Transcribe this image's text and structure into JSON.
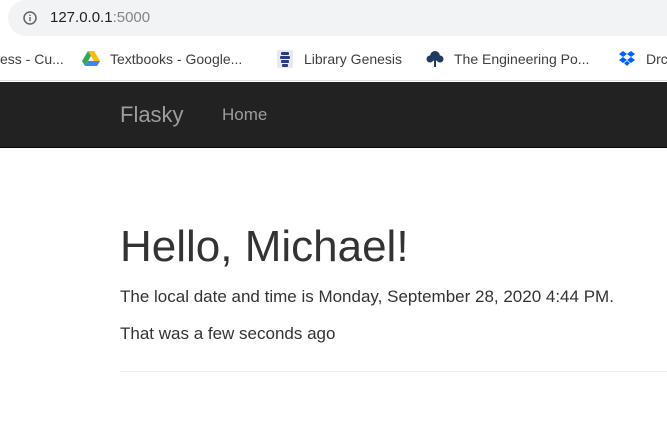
{
  "browser": {
    "url_host": "127.0.0.1",
    "url_port": ":5000",
    "bookmarks": [
      {
        "label": "ess - Cu...",
        "icon": "partial-bookmark"
      },
      {
        "label": "Textbooks - Google...",
        "icon": "google-drive-icon"
      },
      {
        "label": "Library Genesis",
        "icon": "library-genesis-icon"
      },
      {
        "label": "The Engineering Po...",
        "icon": "tree-icon"
      },
      {
        "label": "Drc",
        "icon": "dropbox-icon"
      }
    ]
  },
  "navbar": {
    "brand": "Flasky",
    "home": "Home",
    "background": "#222222"
  },
  "content": {
    "heading": "Hello, Michael!",
    "datetime_text": "The local date and time is Monday, September 28, 2020 4:44 PM.",
    "relative_time_text": "That was a few seconds ago"
  }
}
